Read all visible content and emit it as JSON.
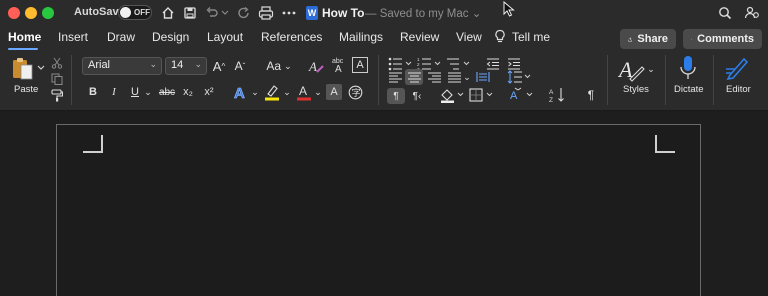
{
  "titlebar": {
    "autosave_label": "AutoSave",
    "autosave_state": "OFF",
    "doc_icon_letter": "W",
    "doc_title": "How To",
    "doc_status": "— Saved to my Mac ⌄"
  },
  "tabs": [
    "Home",
    "Insert",
    "Draw",
    "Design",
    "Layout",
    "References",
    "Mailings",
    "Review",
    "View"
  ],
  "tell_me": "Tell me",
  "share_label": "Share",
  "comments_label": "Comments",
  "ribbon": {
    "paste_label": "Paste",
    "font_name": "Arial",
    "font_size": "14",
    "change_case": "Aa",
    "bold": "B",
    "italic": "I",
    "underline": "U",
    "strikethrough": "abc",
    "subscript": "x₂",
    "superscript": "x²",
    "styles_label": "Styles",
    "dictate_label": "Dictate",
    "editor_label": "Editor"
  },
  "colors": {
    "highlight": "#f4e60a",
    "font_color": "#e03030",
    "accent": "#6aa7ff"
  }
}
